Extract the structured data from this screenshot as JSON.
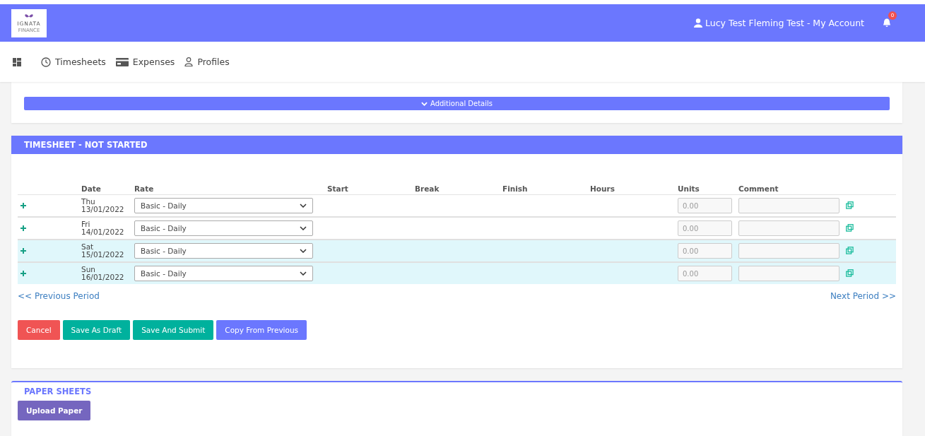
{
  "header": {
    "logo": {
      "name": "IGNATA",
      "sub": "FINANCE"
    },
    "account": "Lucy Test Fleming Test - My Account",
    "notifications": "0"
  },
  "nav": [
    {
      "kind": "dashboard"
    },
    {
      "kind": "clock",
      "label": "Timesheets"
    },
    {
      "kind": "card",
      "label": "Expenses"
    },
    {
      "kind": "person",
      "label": "Profiles"
    }
  ],
  "details_bar": {
    "label": "Additional Details",
    "expanded": false
  },
  "timesheet": {
    "title": "TIMESHEET - NOT STARTED",
    "columns": [
      "Date",
      "Rate",
      "Start",
      "Break",
      "Finish",
      "Hours",
      "Units",
      "Comment"
    ],
    "rows": [
      {
        "day": "Thu",
        "date": "13/01/2022",
        "rate": "Basic - Daily",
        "placeholder": "0.00",
        "highlighted": false
      },
      {
        "day": "Fri",
        "date": "14/01/2022",
        "rate": "Basic - Daily",
        "placeholder": "0.00",
        "highlighted": false
      },
      {
        "day": "Sat",
        "date": "15/01/2022",
        "rate": "Basic - Daily",
        "placeholder": "0.00",
        "highlighted": true
      },
      {
        "day": "Sun",
        "date": "16/01/2022",
        "rate": "Basic - Daily",
        "placeholder": "0.00",
        "highlighted": true
      }
    ],
    "previous": "<< Previous Period",
    "next": "Next Period >>",
    "buttons": [
      {
        "kind": "danger",
        "label": "Cancel"
      },
      {
        "kind": "success",
        "label": "Save As Draft"
      },
      {
        "kind": "success",
        "label": "Save And Submit"
      },
      {
        "kind": "primary",
        "label": "Copy From Previous"
      }
    ]
  },
  "paper_sheets": {
    "title": "PAPER SHEETS",
    "button": "Upload Paper"
  }
}
